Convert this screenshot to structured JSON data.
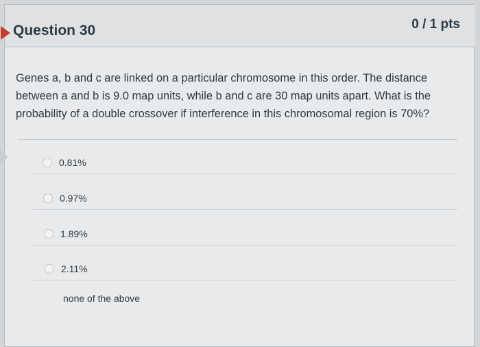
{
  "question": {
    "title": "Question 30",
    "points": "0 / 1 pts",
    "text_line1": "Genes a, b and c are linked on a particular chromosome in this order. The distance",
    "text_line2": "between a and b is 9.0 map units, while b and c are 30 map units apart. What is the",
    "text_line3": "probability of a double crossover if interference in this chromosomal region is 70%?"
  },
  "answers": [
    {
      "label": "0.81%"
    },
    {
      "label": "0.97%"
    },
    {
      "label": "1.89%"
    },
    {
      "label": "2.11%"
    },
    {
      "label": "none of the above"
    }
  ],
  "colors": {
    "flag": "#c53b2c",
    "text": "#2d3b45",
    "header_bg": "#dfe1e3",
    "card_bg": "#e9eaeb"
  }
}
